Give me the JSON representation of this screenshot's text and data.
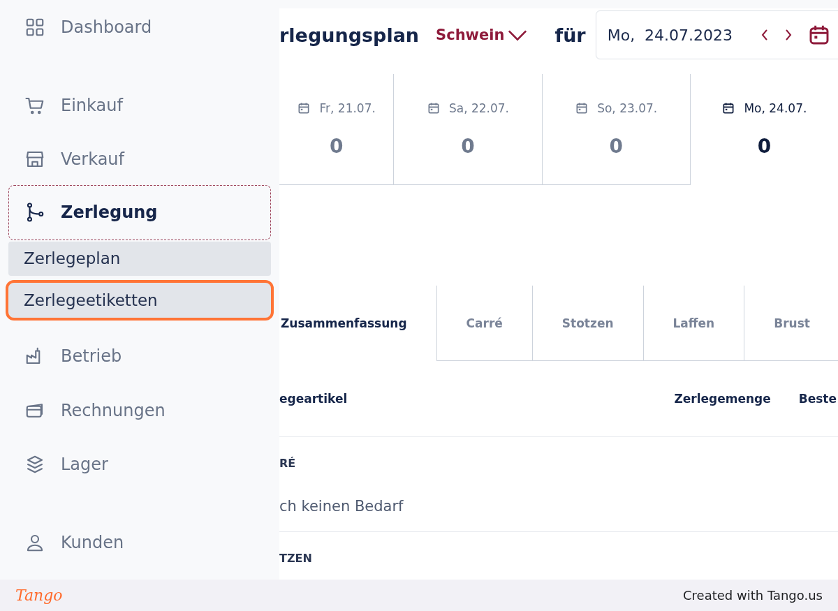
{
  "sidebar": {
    "items": [
      {
        "label": "Dashboard",
        "kind": "item",
        "expanded": false
      },
      {
        "label": "Einkauf",
        "kind": "item",
        "expanded": false
      },
      {
        "label": "Verkauf",
        "kind": "item",
        "expanded": false
      },
      {
        "label": "Zerlegung",
        "kind": "item",
        "expanded": true,
        "children": [
          {
            "label": "Zerlegeplan",
            "selected": false,
            "highlighted": false
          },
          {
            "label": "Zerlegeetiketten",
            "selected": false,
            "highlighted": true
          }
        ]
      },
      {
        "label": "Betrieb",
        "kind": "item",
        "expanded": false
      },
      {
        "label": "Rechnungen",
        "kind": "item",
        "expanded": false
      },
      {
        "label": "Lager",
        "kind": "item",
        "expanded": false
      },
      {
        "label": "Kunden",
        "kind": "item",
        "expanded": false
      }
    ]
  },
  "header": {
    "title": "rlegungsplan",
    "animal": "Schwein",
    "for_label": "für",
    "date": "Mo,  24.07.2023"
  },
  "days": [
    {
      "label": "Fr, 21.07.",
      "value": "0",
      "selected": false
    },
    {
      "label": "Sa, 22.07.",
      "value": "0",
      "selected": false
    },
    {
      "label": "So, 23.07.",
      "value": "0",
      "selected": false
    },
    {
      "label": "Mo, 24.07.",
      "value": "0",
      "selected": true
    }
  ],
  "tabs": [
    {
      "label": "Zusammenfassung",
      "selected": true
    },
    {
      "label": "Carré",
      "selected": false
    },
    {
      "label": "Stotzen",
      "selected": false
    },
    {
      "label": "Laffen",
      "selected": false
    },
    {
      "label": "Brust",
      "selected": false
    }
  ],
  "table": {
    "columns": [
      "egeartikel",
      "Zerlegemenge",
      "Beste"
    ],
    "groups": [
      {
        "title": "RÉ",
        "note": "ch keinen Bedarf"
      },
      {
        "title": "TZEN"
      }
    ]
  },
  "footer": {
    "logo": "Tango",
    "credit": "Created with Tango.us"
  }
}
